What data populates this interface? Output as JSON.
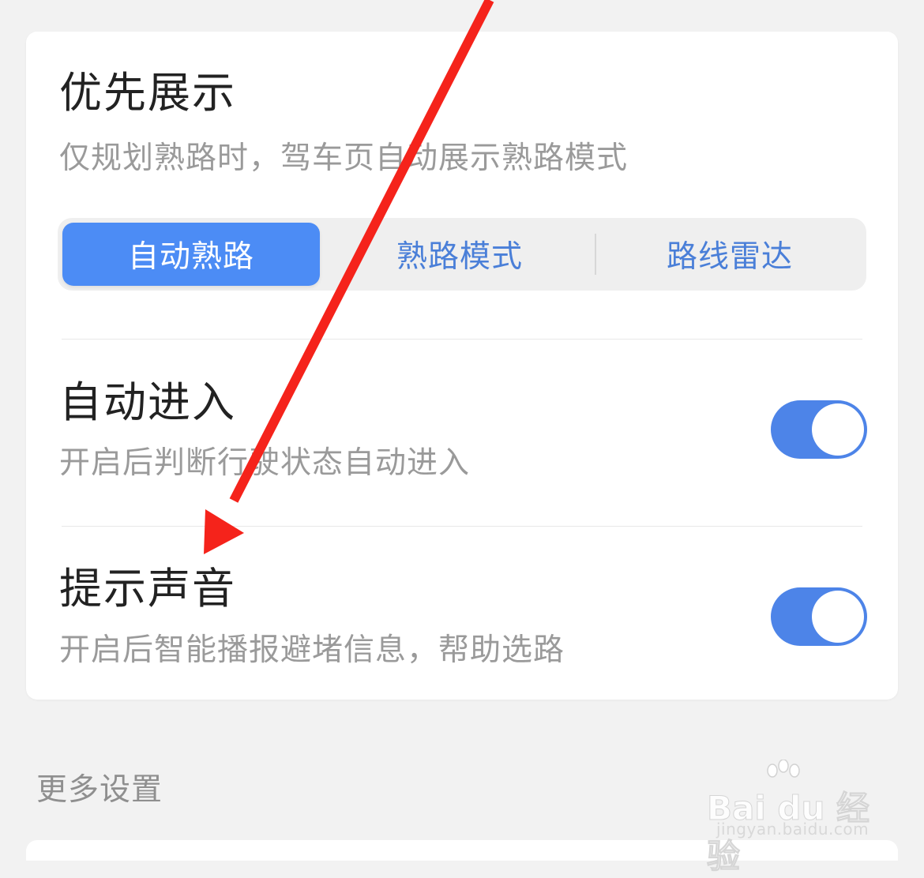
{
  "priority_display": {
    "title": "优先展示",
    "description": "仅规划熟路时，驾车页自动展示熟路模式",
    "options": [
      {
        "label": "自动熟路",
        "selected": true
      },
      {
        "label": "熟路模式",
        "selected": false
      },
      {
        "label": "路线雷达",
        "selected": false
      }
    ]
  },
  "auto_enter": {
    "title": "自动进入",
    "description": "开启后判断行驶状态自动进入",
    "enabled": true
  },
  "sound_alert": {
    "title": "提示声音",
    "description": "开启后智能播报避堵信息，帮助选路",
    "enabled": true
  },
  "more_settings": {
    "label": "更多设置"
  },
  "watermark": {
    "brand": "Bai du 经验",
    "url": "jingyan.baidu.com"
  },
  "colors": {
    "accent": "#4c8cf5",
    "toggle_on": "#4d84e8",
    "annotation_arrow": "#f5231b"
  }
}
